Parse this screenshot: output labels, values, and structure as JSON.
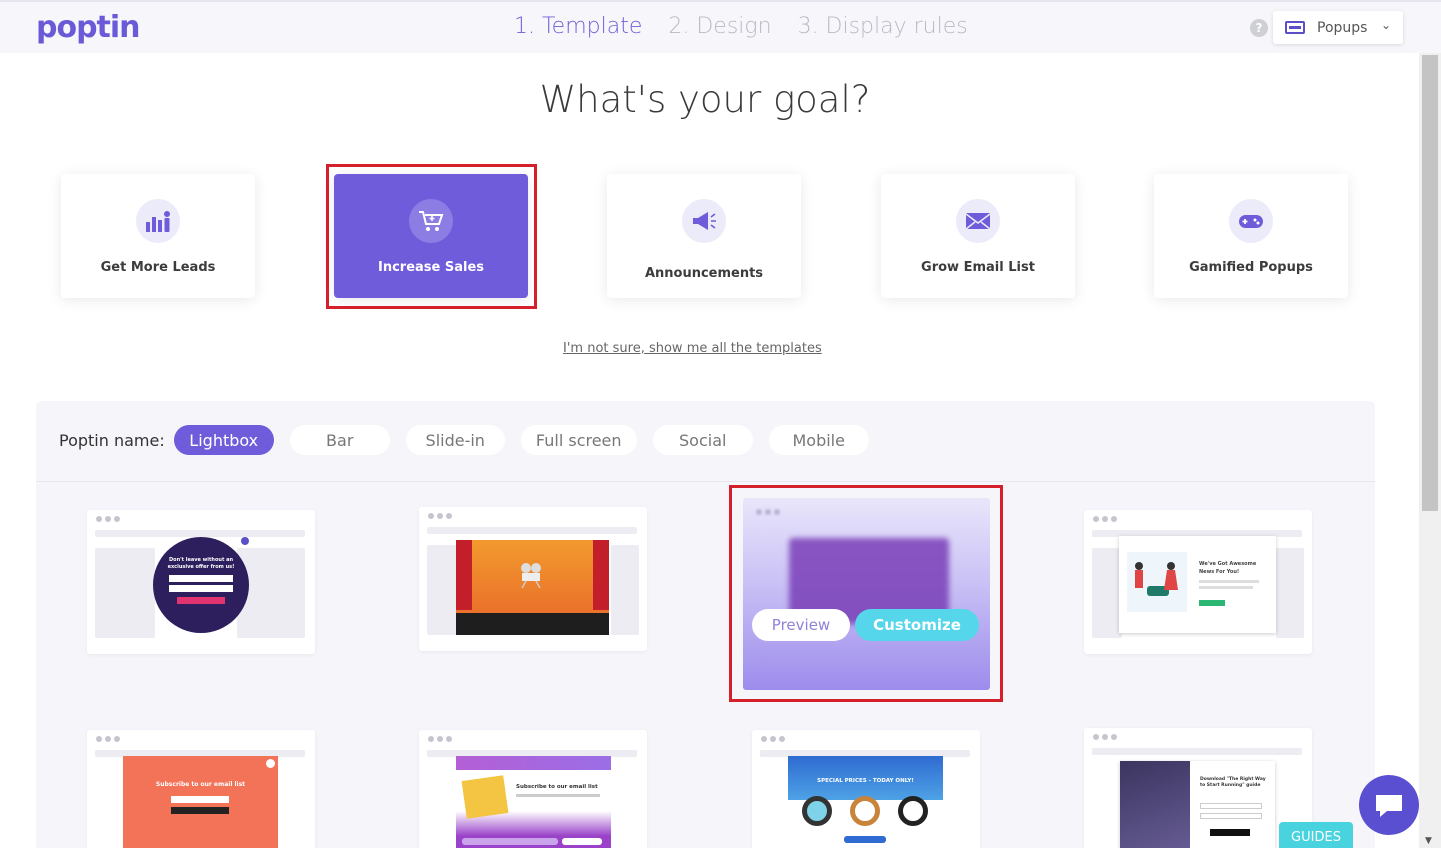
{
  "brand": {
    "logo_text": "poptin",
    "accent": "#6f5cdb"
  },
  "steps": [
    {
      "label": "1. Template",
      "active": true
    },
    {
      "label": "2. Design",
      "active": false
    },
    {
      "label": "3. Display rules",
      "active": false
    }
  ],
  "header": {
    "help_icon": "?",
    "type_select": {
      "value": "Popups",
      "icon": "popup-window-icon"
    }
  },
  "page_title": "What's your goal?",
  "goals": [
    {
      "label": "Get More Leads",
      "icon": "chart-user-icon"
    },
    {
      "label": "Increase Sales",
      "icon": "shopping-cart-icon",
      "selected": true
    },
    {
      "label": "Announcements",
      "icon": "megaphone-icon"
    },
    {
      "label": "Grow Email List",
      "icon": "envelope-icon"
    },
    {
      "label": "Gamified Popups",
      "icon": "gamepad-icon"
    }
  ],
  "show_all_link": "I'm not sure, show me all the templates",
  "filter": {
    "label": "Poptin name:",
    "options": [
      {
        "label": "Lightbox",
        "active": true
      },
      {
        "label": "Bar"
      },
      {
        "label": "Slide-in"
      },
      {
        "label": "Full screen"
      },
      {
        "label": "Social"
      },
      {
        "label": "Mobile"
      }
    ]
  },
  "template_cards": {
    "t1": {
      "lines": [
        "Don't leave without an",
        "exclusive offer from us!"
      ]
    },
    "t4": {
      "lines": [
        "We've Got Awesome",
        "News For You!"
      ]
    },
    "t5": {
      "title": "Subscribe to our email list"
    },
    "t6": {
      "title": "Subscribe to our email list"
    },
    "t7": {
      "title": "SPECIAL PRICES - TODAY ONLY!"
    },
    "t8": {
      "lines": [
        "Download \"The Right Way",
        "to Start Running\" guide"
      ]
    }
  },
  "hover_card": {
    "preview_label": "Preview",
    "customize_label": "Customize"
  },
  "guides_label": "GUIDES"
}
